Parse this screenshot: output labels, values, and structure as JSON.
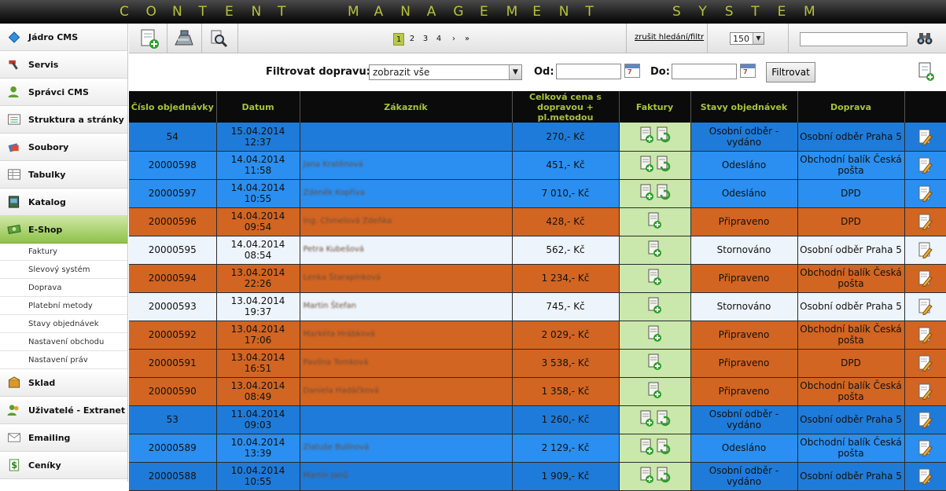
{
  "app": {
    "title": "CONTENT MANAGEMENT SYSTEM"
  },
  "sidebar": {
    "items": [
      {
        "label": "Jádro CMS",
        "icon": "diamond-icon"
      },
      {
        "label": "Servis",
        "icon": "hammer-icon"
      },
      {
        "label": "Správci CMS",
        "icon": "admin-user-icon"
      },
      {
        "label": "Struktura a stránky",
        "icon": "structure-list-icon"
      },
      {
        "label": "Soubory",
        "icon": "files-icon"
      },
      {
        "label": "Tabulky",
        "icon": "table-icon"
      },
      {
        "label": "Katalog",
        "icon": "catalog-icon"
      },
      {
        "label": "E-Shop",
        "icon": "money-icon"
      },
      {
        "label": "Sklad",
        "icon": "warehouse-box-icon"
      },
      {
        "label": "Uživatelé - Extranet",
        "icon": "users-icon"
      },
      {
        "label": "Emailing",
        "icon": "envelope-icon"
      },
      {
        "label": "Ceníky",
        "icon": "dollar-icon"
      }
    ],
    "eshop_sub": [
      "Faktury",
      "Slevový systém",
      "Doprava",
      "Platební metody",
      "Stavy objednávek",
      "Nastavení obchodu",
      "Nastavení práv"
    ]
  },
  "toolbar": {
    "buttons": [
      "add-document-icon",
      "cash-register-icon",
      "magnifier-tool-icon"
    ],
    "pages": [
      "1",
      "2",
      "3",
      "4",
      "›",
      "»"
    ],
    "current_page": "1",
    "clear_filter": "zrušit hledání/filtr",
    "per_page": "150",
    "search_value": ""
  },
  "filter": {
    "transport_label": "Filtrovat dopravu:",
    "transport_value": "zobrazit vše",
    "from_label": "Od:",
    "to_label": "Do:",
    "button": "Filtrovat"
  },
  "table": {
    "headers": [
      "Číslo objednávky",
      "Datum",
      "Zákazník",
      "Celková cena s dopravou + pl.metodou",
      "Faktury",
      "Stavy objednávek",
      "Doprava",
      ""
    ],
    "rows": [
      {
        "num": "54",
        "date": "15.04.2014 12:37",
        "customer": "",
        "price": "270,- Kč",
        "invoices": 2,
        "status": "Osobní odběr - vydáno",
        "transport": "Osobní odběr Praha 5",
        "color": "blue"
      },
      {
        "num": "20000598",
        "date": "14.04.2014 11:58",
        "customer": "Jana Kratěnová",
        "price": "451,- Kč",
        "invoices": 2,
        "status": "Odesláno",
        "transport": "Obchodní balík Česká pošta",
        "color": "lblue"
      },
      {
        "num": "20000597",
        "date": "14.04.2014 10:55",
        "customer": "Zdeněk Kopřiva",
        "price": "7 010,- Kč",
        "invoices": 2,
        "status": "Odesláno",
        "transport": "DPD",
        "color": "lblue"
      },
      {
        "num": "20000596",
        "date": "14.04.2014 09:54",
        "customer": "Ing. Chmelová Zdeňka",
        "price": "428,- Kč",
        "invoices": 1,
        "status": "Připraveno",
        "transport": "DPD",
        "color": "orange"
      },
      {
        "num": "20000595",
        "date": "14.04.2014 08:54",
        "customer": "Petra Kubešová",
        "price": "562,- Kč",
        "invoices": 1,
        "status": "Stornováno",
        "transport": "Osobní odběr Praha 5",
        "color": "white"
      },
      {
        "num": "20000594",
        "date": "13.04.2014 22:26",
        "customer": "Lenka Štarapínková",
        "price": "1 234,- Kč",
        "invoices": 1,
        "status": "Připraveno",
        "transport": "Obchodní balík Česká pošta",
        "color": "orange"
      },
      {
        "num": "20000593",
        "date": "13.04.2014 19:37",
        "customer": "Martin Štefan",
        "price": "745,- Kč",
        "invoices": 1,
        "status": "Stornováno",
        "transport": "Osobní odběr Praha 5",
        "color": "white"
      },
      {
        "num": "20000592",
        "date": "13.04.2014 17:06",
        "customer": "Markéta Hrábková",
        "price": "2 029,- Kč",
        "invoices": 1,
        "status": "Připraveno",
        "transport": "Obchodní balík Česká pošta",
        "color": "orange"
      },
      {
        "num": "20000591",
        "date": "13.04.2014 16:51",
        "customer": "Pavlína Tomková",
        "price": "3 538,- Kč",
        "invoices": 1,
        "status": "Připraveno",
        "transport": "DPD",
        "color": "orange"
      },
      {
        "num": "20000590",
        "date": "13.04.2014 08:49",
        "customer": "Daniela Hadáčková",
        "price": "1 358,- Kč",
        "invoices": 1,
        "status": "Připraveno",
        "transport": "Obchodní balík Česká pošta",
        "color": "orange"
      },
      {
        "num": "53",
        "date": "11.04.2014 09:03",
        "customer": "",
        "price": "1 260,- Kč",
        "invoices": 2,
        "status": "Osobní odběr - vydáno",
        "transport": "Osobní odběr Praha 5",
        "color": "blue"
      },
      {
        "num": "20000589",
        "date": "10.04.2014 13:39",
        "customer": "Zlatuše Bulínová",
        "price": "2 129,- Kč",
        "invoices": 2,
        "status": "Odesláno",
        "transport": "Obchodní balík Česká pošta",
        "color": "lblue"
      },
      {
        "num": "20000588",
        "date": "10.04.2014 10:55",
        "customer": "Martin Janů",
        "price": "1 909,- Kč",
        "invoices": 2,
        "status": "Osobní odběr - vydáno",
        "transport": "Osobní odběr Praha 5",
        "color": "blue"
      }
    ]
  }
}
